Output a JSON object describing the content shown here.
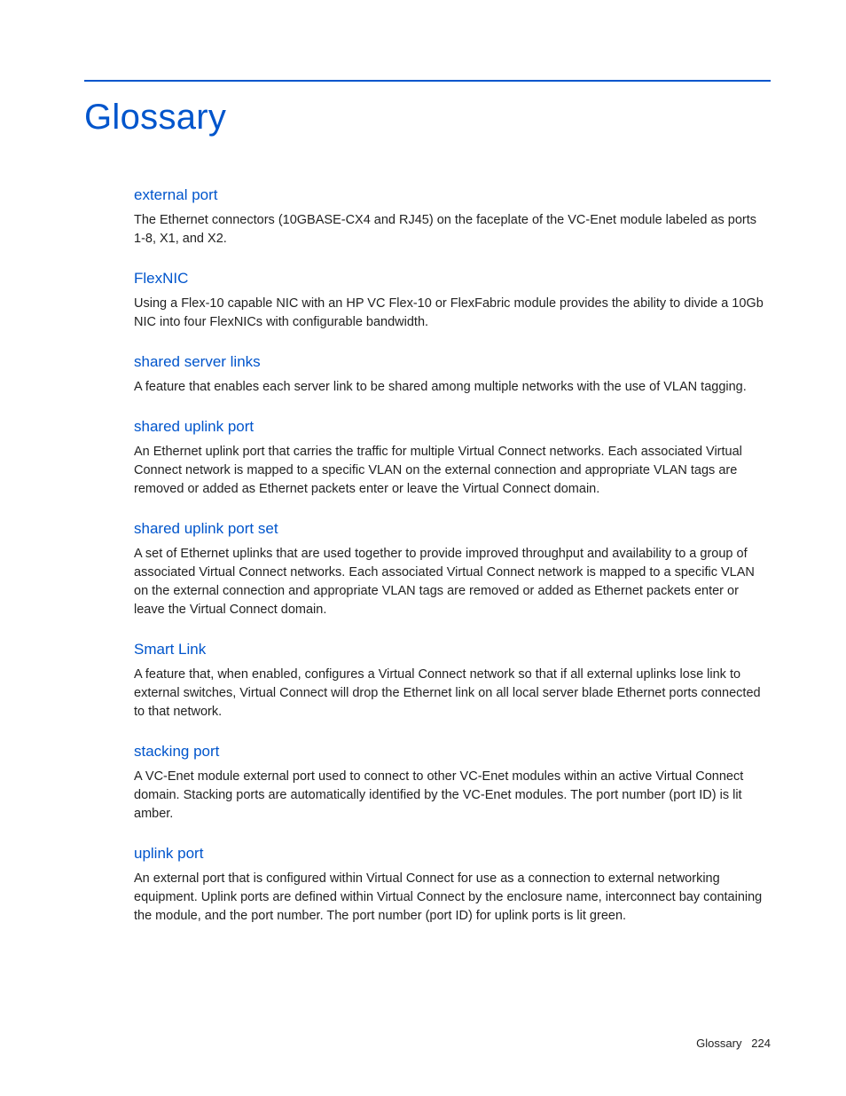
{
  "page": {
    "title": "Glossary",
    "footer_label": "Glossary",
    "footer_page": "224"
  },
  "entries": [
    {
      "term": "external port",
      "definition": "The Ethernet connectors (10GBASE-CX4 and RJ45) on the faceplate of the VC-Enet module labeled as ports 1-8, X1, and X2."
    },
    {
      "term": "FlexNIC",
      "definition": "Using a Flex-10 capable NIC with an HP VC Flex-10 or FlexFabric module provides the ability to divide a 10Gb NIC into four FlexNICs with configurable bandwidth."
    },
    {
      "term": "shared server links",
      "definition": "A feature that enables each server link to be shared among multiple networks with the use of VLAN tagging."
    },
    {
      "term": "shared uplink port",
      "definition": "An Ethernet uplink port that carries the traffic for multiple Virtual Connect networks. Each associated Virtual Connect network is mapped to a specific VLAN on the external connection and appropriate VLAN tags are removed or added as Ethernet packets enter or leave the Virtual Connect domain."
    },
    {
      "term": "shared uplink port set",
      "definition": "A set of Ethernet uplinks that are used together to provide improved throughput and availability to a group of associated Virtual Connect networks. Each associated Virtual Connect network is mapped to a specific VLAN on the external connection and appropriate VLAN tags are removed or added as Ethernet packets enter or leave the Virtual Connect domain."
    },
    {
      "term": "Smart Link",
      "definition": "A feature that, when enabled, configures a Virtual Connect network so that if all external uplinks lose link to external switches, Virtual Connect will drop the Ethernet link on all local server blade Ethernet ports connected to that network."
    },
    {
      "term": "stacking port",
      "definition": "A VC-Enet module external port used to connect to other VC-Enet modules within an active Virtual Connect domain. Stacking ports are automatically identified by the VC-Enet modules. The port number (port ID) is lit amber."
    },
    {
      "term": "uplink port",
      "definition": "An external port that is configured within Virtual Connect for use as a connection to external networking equipment. Uplink ports are defined within Virtual Connect by the enclosure name, interconnect bay containing the module, and the port number. The port number (port ID) for uplink ports is lit green."
    }
  ]
}
